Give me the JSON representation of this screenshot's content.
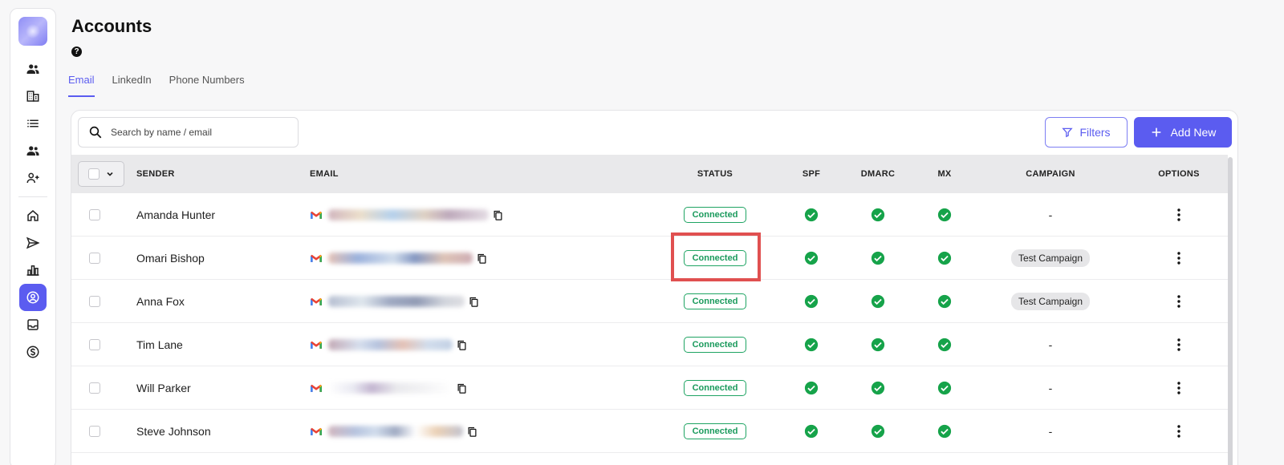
{
  "page": {
    "title": "Accounts",
    "help_glyph": "?"
  },
  "tabs": [
    {
      "label": "Email",
      "active": true
    },
    {
      "label": "LinkedIn",
      "active": false
    },
    {
      "label": "Phone Numbers",
      "active": false
    }
  ],
  "toolbar": {
    "search_placeholder": "Search by name / email",
    "filters_label": "Filters",
    "add_new_label": "Add New"
  },
  "table": {
    "headers": {
      "sender": "SENDER",
      "email": "EMAIL",
      "status": "STATUS",
      "spf": "SPF",
      "dmarc": "DMARC",
      "mx": "MX",
      "campaign": "CAMPAIGN",
      "options": "OPTIONS"
    },
    "rows": [
      {
        "sender": "Amanda Hunter",
        "status": "Connected",
        "campaign": "-"
      },
      {
        "sender": "Omari Bishop",
        "status": "Connected",
        "campaign": "Test Campaign"
      },
      {
        "sender": "Anna Fox",
        "status": "Connected",
        "campaign": "Test Campaign"
      },
      {
        "sender": "Tim Lane",
        "status": "Connected",
        "campaign": "-"
      },
      {
        "sender": "Will Parker",
        "status": "Connected",
        "campaign": "-"
      },
      {
        "sender": "Steve Johnson",
        "status": "Connected",
        "campaign": "-"
      }
    ]
  },
  "colors": {
    "accent": "#5b5cf0",
    "connected": "#1a9a5c",
    "check": "#16a34a",
    "highlight": "#e05050"
  },
  "icons": {
    "sidebar": [
      "users-icon",
      "building-icon",
      "list-icon",
      "contacts-icon",
      "add-user-icon",
      "home-icon",
      "send-icon",
      "bar-chart-icon",
      "account-circle-icon",
      "inbox-icon",
      "dollar-icon"
    ]
  }
}
